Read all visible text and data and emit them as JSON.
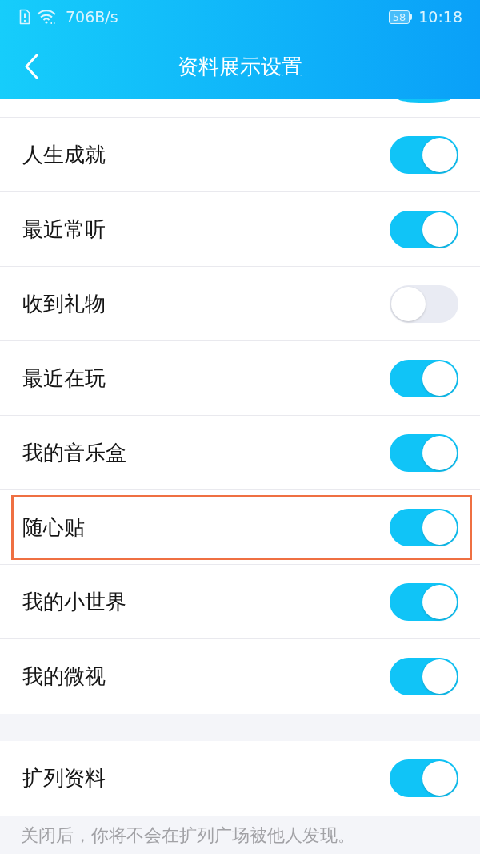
{
  "status_bar": {
    "network_speed": "706B/s",
    "battery": "58",
    "time": "10:18"
  },
  "header": {
    "title": "资料展示设置"
  },
  "settings": [
    {
      "kind": "clipped",
      "on": true,
      "highlighted": false
    },
    {
      "kind": "toggle",
      "label": "人生成就",
      "on": true,
      "highlighted": false
    },
    {
      "kind": "toggle",
      "label": "最近常听",
      "on": true,
      "highlighted": false
    },
    {
      "kind": "toggle",
      "label": "收到礼物",
      "on": false,
      "highlighted": false
    },
    {
      "kind": "toggle",
      "label": "最近在玩",
      "on": true,
      "highlighted": false
    },
    {
      "kind": "toggle",
      "label": "我的音乐盒",
      "on": true,
      "highlighted": false
    },
    {
      "kind": "toggle",
      "label": "随心贴",
      "on": true,
      "highlighted": true
    },
    {
      "kind": "toggle",
      "label": "我的小世界",
      "on": true,
      "highlighted": false
    },
    {
      "kind": "toggle",
      "label": "我的微视",
      "on": true,
      "highlighted": false
    }
  ],
  "extra_settings": [
    {
      "kind": "toggle",
      "label": "扩列资料",
      "on": true,
      "highlighted": false
    }
  ],
  "footnote": "关闭后，你将不会在扩列广场被他人发现。"
}
